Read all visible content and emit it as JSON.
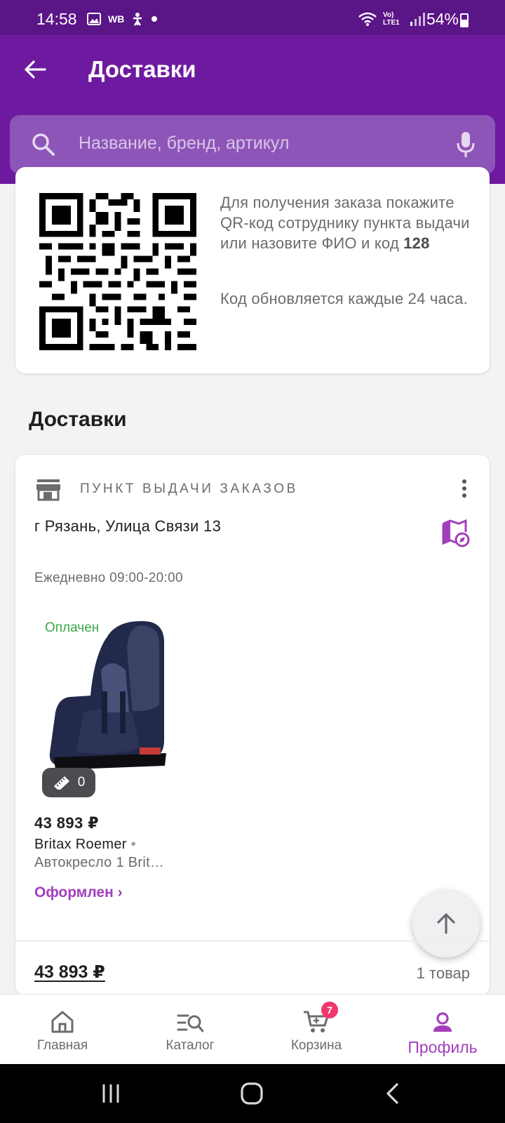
{
  "status_bar": {
    "time": "14:58",
    "wb_badge": "WB",
    "network_label": "Vo) LTE1",
    "battery": "54%"
  },
  "header": {
    "title": "Доставки"
  },
  "search": {
    "placeholder": "Название, бренд, артикул"
  },
  "qr_card": {
    "instruction": "Для получения заказа покажите QR-код сотруднику пункта выдачи или назовите ФИО и код",
    "code": "128",
    "note": "Код обновляется каждые 24 часа."
  },
  "section_title": "Доставки",
  "delivery": {
    "type_label": "ПУНКТ ВЫДАЧИ ЗАКАЗОВ",
    "address": "г Рязань, Улица Связи 13",
    "hours": "Ежедневно 09:00-20:00",
    "item": {
      "payment_status": "Оплачен",
      "size_count": "0",
      "price": "43 893 ₽",
      "brand": "Britax Roemer",
      "name": "Автокресло 1 Brit…",
      "status": "Оформлен ›"
    },
    "total": "43 893 ₽",
    "items_count": "1 товар"
  },
  "bottom_nav": {
    "items": [
      {
        "label": "Главная",
        "icon": "home-icon"
      },
      {
        "label": "Каталог",
        "icon": "catalog-search-icon"
      },
      {
        "label": "Корзина",
        "icon": "cart-icon",
        "badge": "7"
      },
      {
        "label": "Профиль",
        "icon": "profile-icon",
        "active": true
      }
    ]
  },
  "colors": {
    "brand_purple": "#6e1aa0",
    "accent": "#a33fbc",
    "paid_green": "#3aa84a",
    "badge_pink": "#f0386b"
  }
}
